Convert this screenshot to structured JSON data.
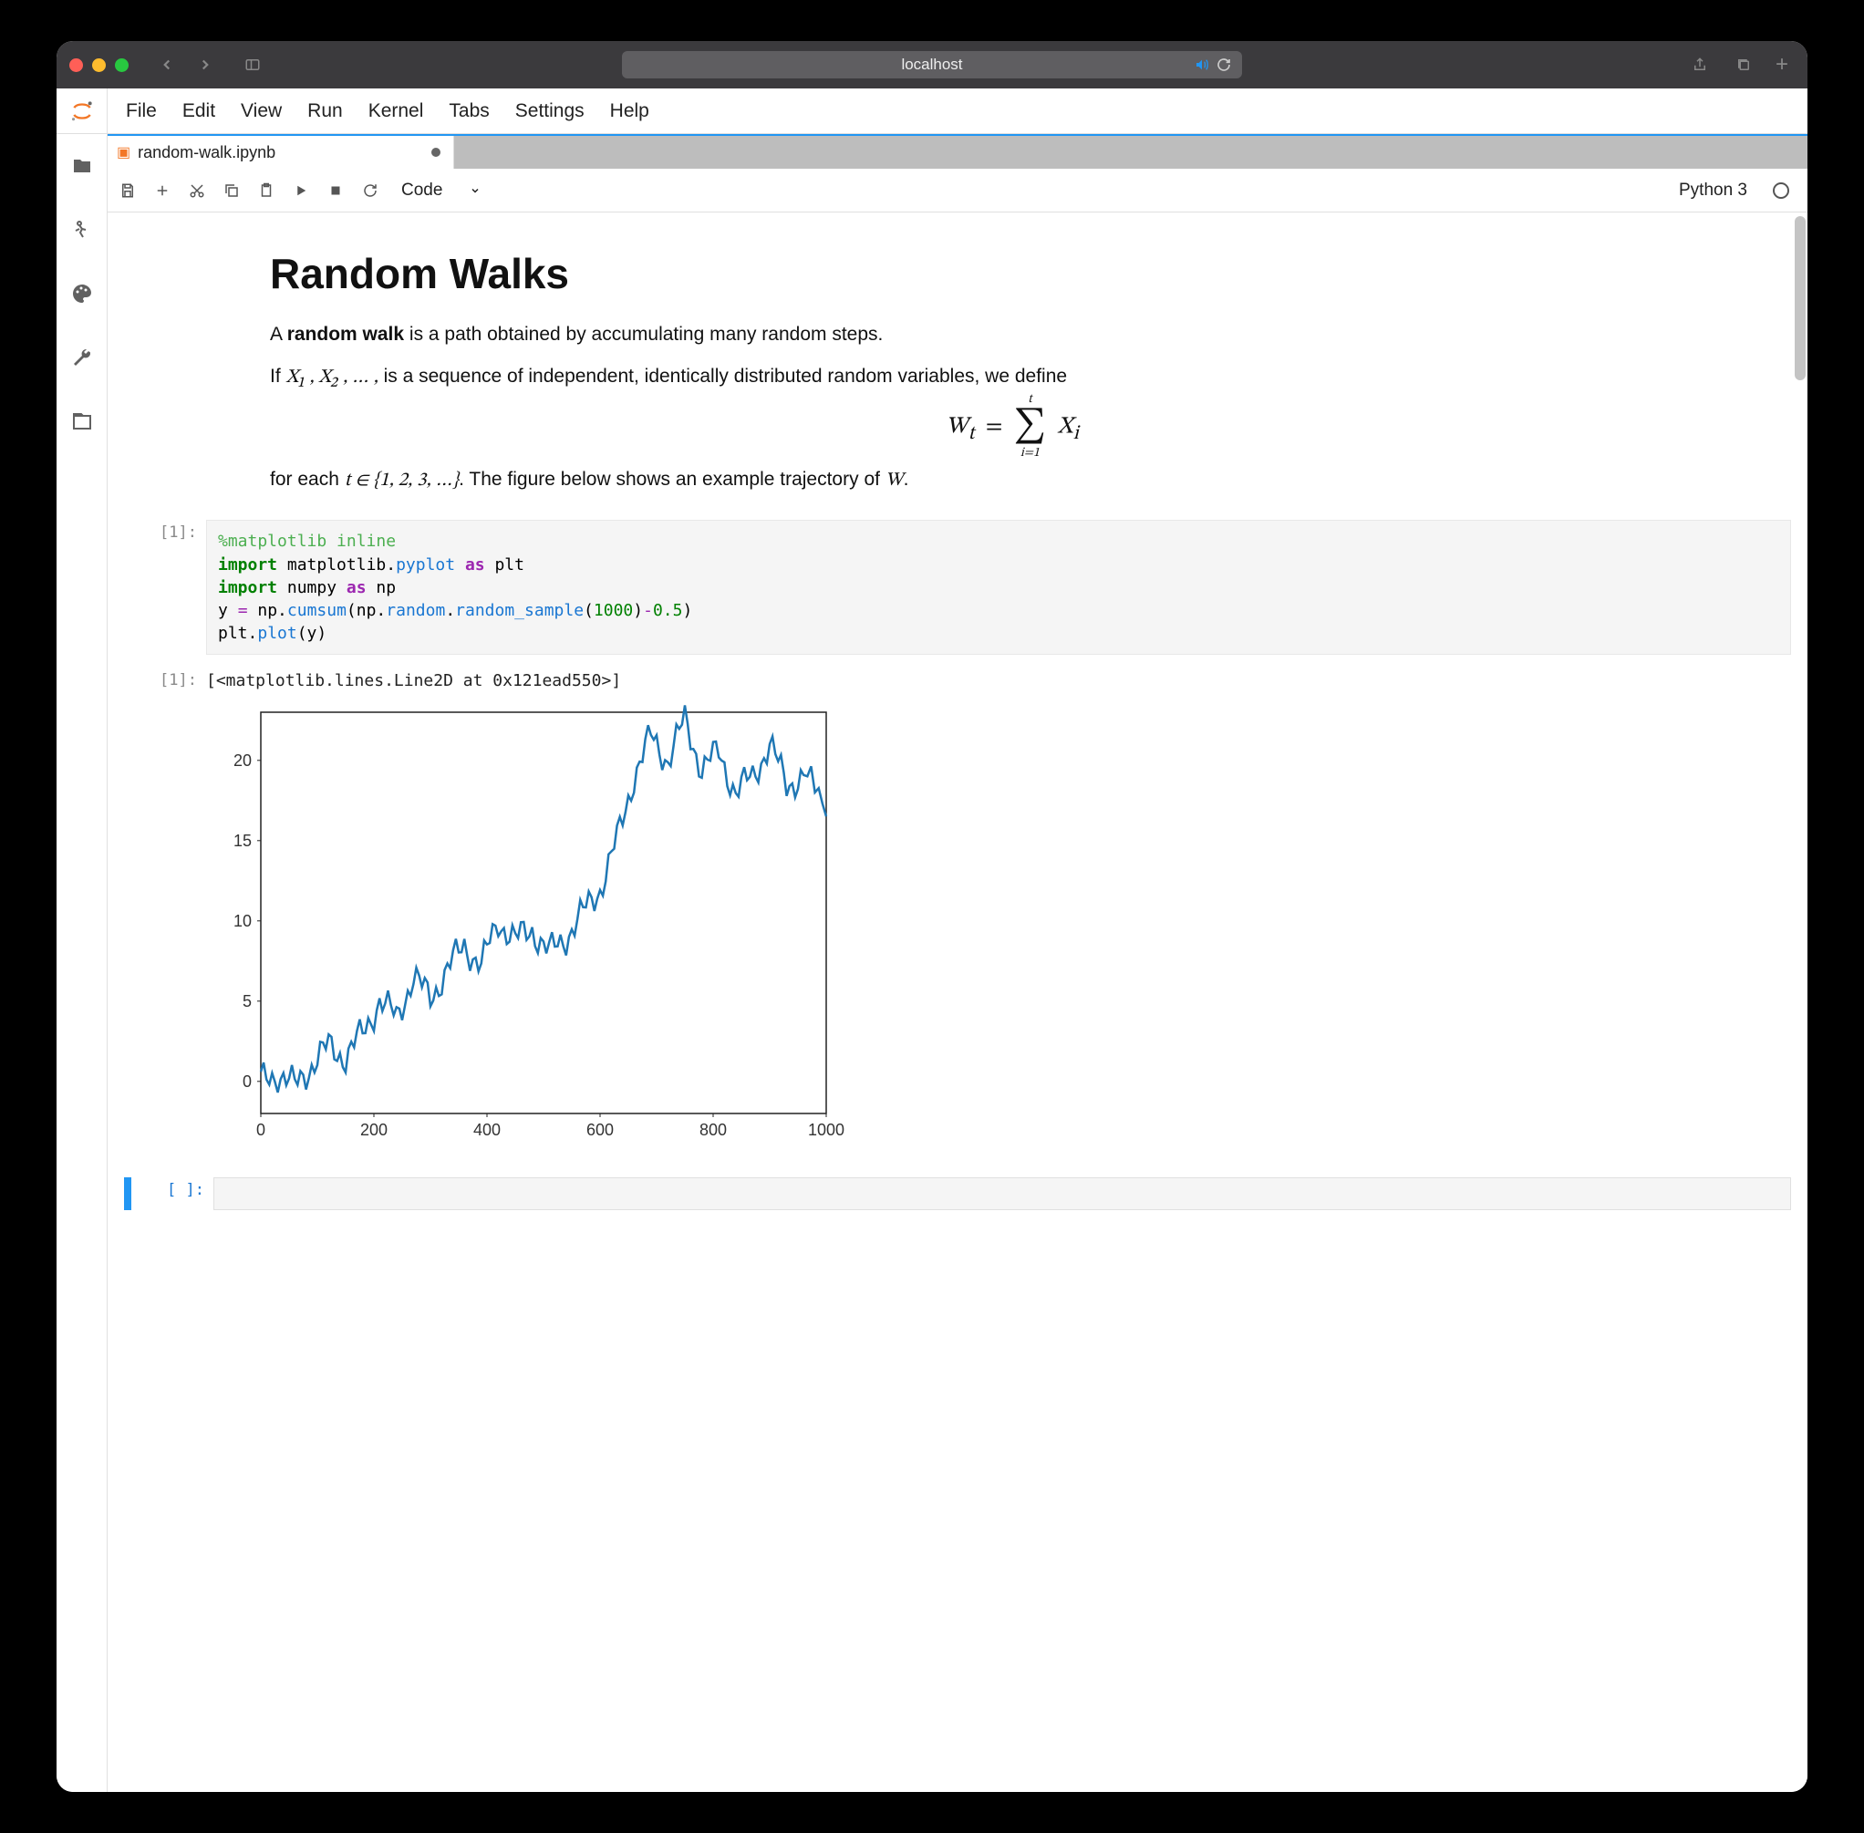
{
  "browser": {
    "url": "localhost"
  },
  "menus": [
    "File",
    "Edit",
    "View",
    "Run",
    "Kernel",
    "Tabs",
    "Settings",
    "Help"
  ],
  "tab": {
    "filename": "random-walk.ipynb",
    "modified": true
  },
  "toolbar": {
    "celltype": "Code"
  },
  "kernel": {
    "name": "Python 3"
  },
  "markdown": {
    "title": "Random Walks",
    "p1a": "A ",
    "p1b": "random walk",
    "p1c": " is a path obtained by accumulating many random steps.",
    "p2a": "If ",
    "p2b": "X₁ , X₂ , … ,",
    "p2c": " is a sequence of independent, identically distributed random variables, we define",
    "formula_html": "W<sub>t</sub> = ∑<span style='font-size:14px;vertical-align:18px;margin-left:-18px;'>t</span><span style='font-size:14px;vertical-align:-14px;margin-left:-10px;'>i=1</span> X<sub>i</sub>",
    "p3a": "for each ",
    "p3b": "t ∈ {1, 2, 3, …}",
    "p3c": ". The figure below shows an example trajectory of ",
    "p3d": "W",
    "p3e": "."
  },
  "prompts": {
    "in1": "[1]:",
    "out1": "[1]:",
    "empty": "[ ]:"
  },
  "code": {
    "l1": "%matplotlib inline",
    "l2a": "import",
    "l2b": " matplotlib.",
    "l2c": "pyplot",
    "l2d": " as ",
    "l2e": "plt",
    "l3a": "import",
    "l3b": " numpy ",
    "l3c": "as ",
    "l3d": "np",
    "l4a": "y ",
    "l4b": "=",
    "l4c": " np.",
    "l4d": "cumsum",
    "l4e": "(np.",
    "l4f": "random",
    "l4g": ".",
    "l4h": "random_sample",
    "l4i": "(",
    "l4j": "1000",
    "l4k": ")",
    "l4l": "-",
    "l4m": "0.5",
    "l4n": ")",
    "l5a": "plt.",
    "l5b": "plot",
    "l5c": "(y)"
  },
  "output_text": "[<matplotlib.lines.Line2D at 0x121ead550>]",
  "chart_data": {
    "type": "line",
    "title": "",
    "xlabel": "",
    "ylabel": "",
    "xlim": [
      0,
      1000
    ],
    "ylim": [
      -2,
      23
    ],
    "xticks": [
      0,
      200,
      400,
      600,
      800,
      1000
    ],
    "yticks": [
      0,
      5,
      10,
      15,
      20
    ],
    "series": [
      {
        "name": "y",
        "color": "#1f77b4",
        "x": [
          0,
          30,
          60,
          90,
          120,
          150,
          180,
          210,
          240,
          270,
          300,
          330,
          360,
          390,
          420,
          450,
          480,
          510,
          540,
          570,
          600,
          630,
          660,
          690,
          720,
          750,
          780,
          810,
          840,
          870,
          900,
          930,
          960,
          1000
        ],
        "y": [
          0,
          0.5,
          -0.3,
          1.0,
          2.2,
          1.5,
          3.0,
          5.0,
          4.0,
          6.5,
          5.2,
          7.0,
          8.5,
          7.2,
          10.0,
          8.8,
          9.5,
          8.0,
          9.0,
          10.5,
          12.0,
          15.0,
          19.0,
          21.5,
          20.0,
          22.5,
          19.5,
          20.5,
          18.0,
          19.0,
          21.0,
          18.5,
          19.0,
          17.5
        ]
      }
    ]
  }
}
